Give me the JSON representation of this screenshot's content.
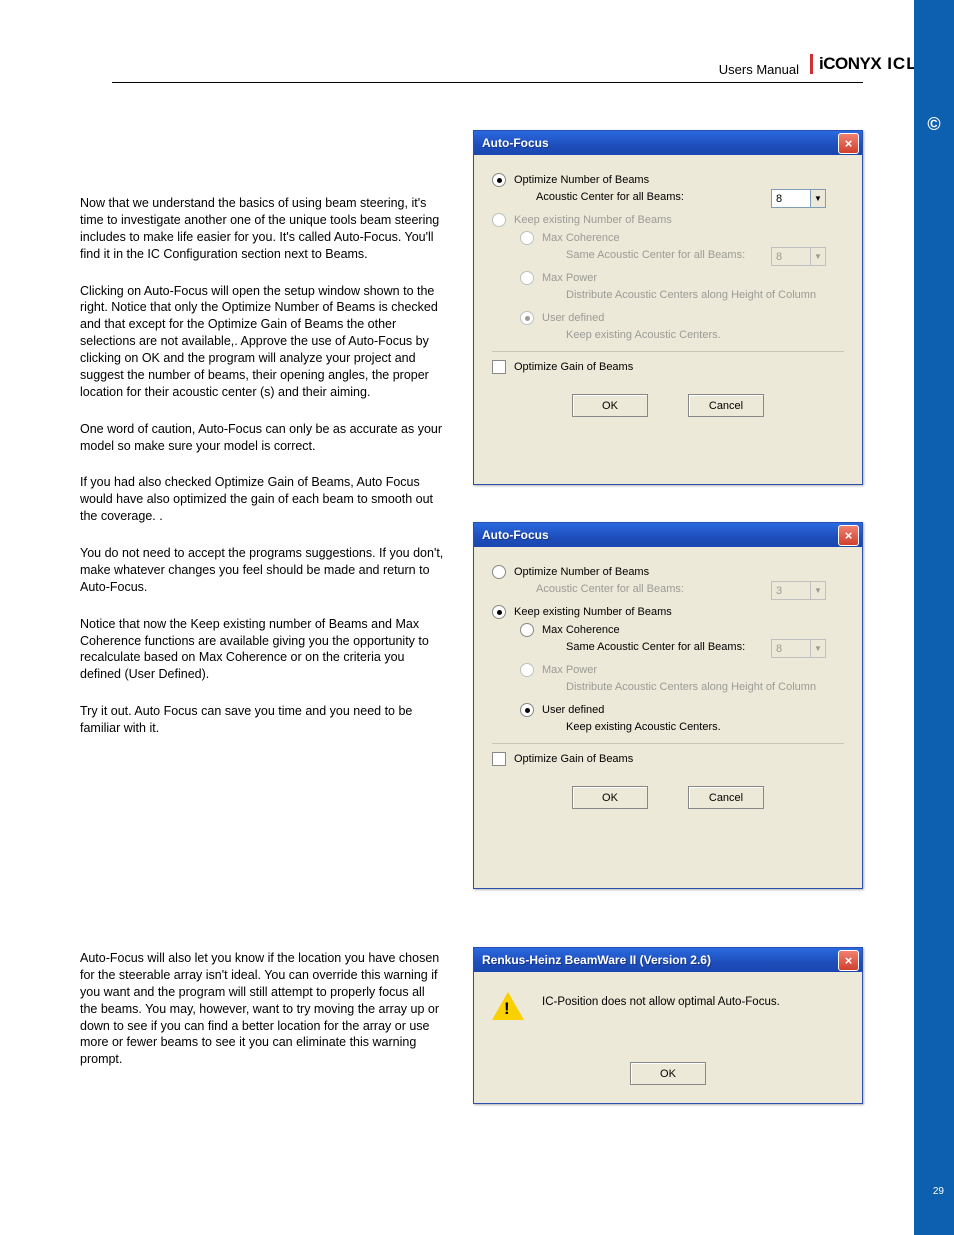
{
  "header": {
    "users_manual": "Users Manual",
    "brand_iconyx": "iCONYX",
    "model": "ICL-FR"
  },
  "page_number": "29",
  "right_bar_glyph": "©",
  "body": {
    "p1": "Now that we understand the basics of using beam steering, it's time to investigate another one of the unique tools beam steering includes to make life easier for you. It's called Auto-Focus.  You'll find it in the IC Configuration section next to Beams.",
    "p2": "Clicking on Auto-Focus will open the setup window shown to the right. Notice that only the Optimize Number of Beams is checked and that except for the Optimize Gain of Beams the other selections are not available,. Approve the use of Auto-Focus by clicking on OK and the program will analyze your project and suggest the number of beams, their opening angles, the proper location for their acoustic center (s) and their aiming.",
    "p3": "One word of caution, Auto-Focus can only be as accurate as your model so make sure your model is correct.",
    "p4": "If you had also checked Optimize Gain of Beams, Auto Focus would have also optimized the gain of each beam to smooth out the coverage. .",
    "p5": "You do not need to accept the programs suggestions. If you don't, make whatever changes you feel should be made and return to Auto-Focus.",
    "p6": "Notice that now the Keep existing number of Beams and Max Coherence functions are available giving you the opportunity to recalculate based on Max Coherence or on the criteria you defined (User Defined).",
    "p7": "Try it out. Auto Focus can save you time and you need to be familiar with it.",
    "p8": "Auto-Focus will also let you know if the location you have chosen for the steerable array isn't ideal. You can override this warning if you want and the program will still attempt to properly focus all the beams. You may, however, want to try moving the array up or down to see if you can find a better location for the array or use more or fewer beams to see it you can eliminate this warning prompt."
  },
  "dialog1": {
    "title": "Auto-Focus",
    "optimize_num": "Optimize Number of Beams",
    "acoustic_center_all": "Acoustic Center for all Beams:",
    "dropdown1_value": "8",
    "keep_existing": "Keep existing Number of Beams",
    "max_coherence": "Max Coherence",
    "same_acoustic": "Same Acoustic Center for all Beams:",
    "dropdown2_value": "8",
    "max_power": "Max Power",
    "distribute": "Distribute Acoustic Centers along Height of Column",
    "user_defined": "User defined",
    "keep_centers": "Keep existing Acoustic Centers.",
    "optimize_gain": "Optimize Gain of Beams",
    "ok": "OK",
    "cancel": "Cancel"
  },
  "dialog2": {
    "title": "Auto-Focus",
    "optimize_num": "Optimize Number of Beams",
    "acoustic_center_all": "Acoustic Center for all Beams:",
    "dropdown1_value": "3",
    "keep_existing": "Keep existing Number of Beams",
    "max_coherence": "Max Coherence",
    "same_acoustic": "Same Acoustic Center for all Beams:",
    "dropdown2_value": "8",
    "max_power": "Max Power",
    "distribute": "Distribute Acoustic Centers along Height of Column",
    "user_defined": "User defined",
    "keep_centers": "Keep existing Acoustic Centers.",
    "optimize_gain": "Optimize Gain of Beams",
    "ok": "OK",
    "cancel": "Cancel"
  },
  "dialog3": {
    "title": "Renkus-Heinz BeamWare II (Version 2.6)",
    "message": "IC-Position does not allow optimal Auto-Focus.",
    "ok": "OK"
  }
}
